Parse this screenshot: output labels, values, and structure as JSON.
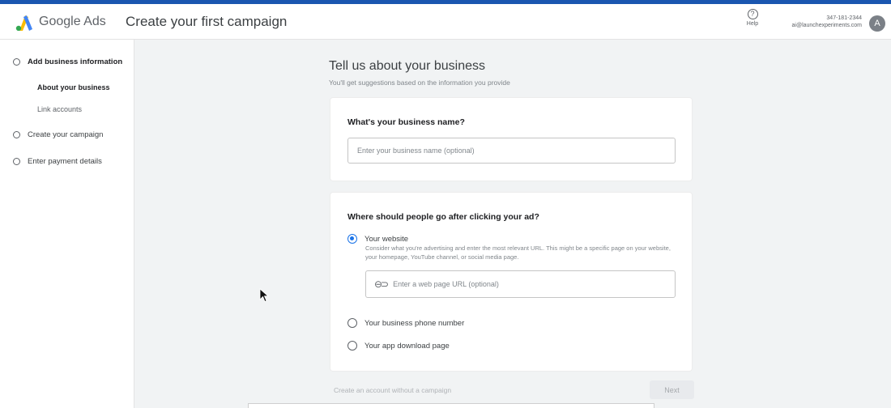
{
  "header": {
    "brand": "Google Ads",
    "page_title": "Create your first campaign",
    "help_label": "Help",
    "help_icon": "?",
    "account_phone": "347-181-2344",
    "account_email": "ai@launchexperiments.com",
    "avatar_letter": "A"
  },
  "sidebar": {
    "steps": [
      {
        "label": "Add business information"
      },
      {
        "label": "About your business"
      },
      {
        "label": "Link accounts"
      },
      {
        "label": "Create your campaign"
      },
      {
        "label": "Enter payment details"
      }
    ]
  },
  "main": {
    "heading": "Tell us about your business",
    "subheading": "You'll get suggestions based on the information you provide",
    "business_name": {
      "question": "What's your business name?",
      "placeholder": "Enter your business name (optional)"
    },
    "destination": {
      "question": "Where should people go after clicking your ad?",
      "options": [
        {
          "label": "Your website",
          "selected": true
        },
        {
          "label": "Your business phone number",
          "selected": false
        },
        {
          "label": "Your app download page",
          "selected": false
        }
      ],
      "website_description": "Consider what you're advertising and enter the most relevant URL. This might be a specific page on your website, your homepage, YouTube channel, or social media page.",
      "url_placeholder": "Enter a web page URL (optional)",
      "link_icon": "⊖⊃"
    },
    "skip_link": "Create an account without a campaign",
    "next_label": "Next"
  },
  "colors": {
    "accent": "#1a73e8",
    "top_bar": "#1a56b0",
    "background": "#f1f3f4"
  }
}
